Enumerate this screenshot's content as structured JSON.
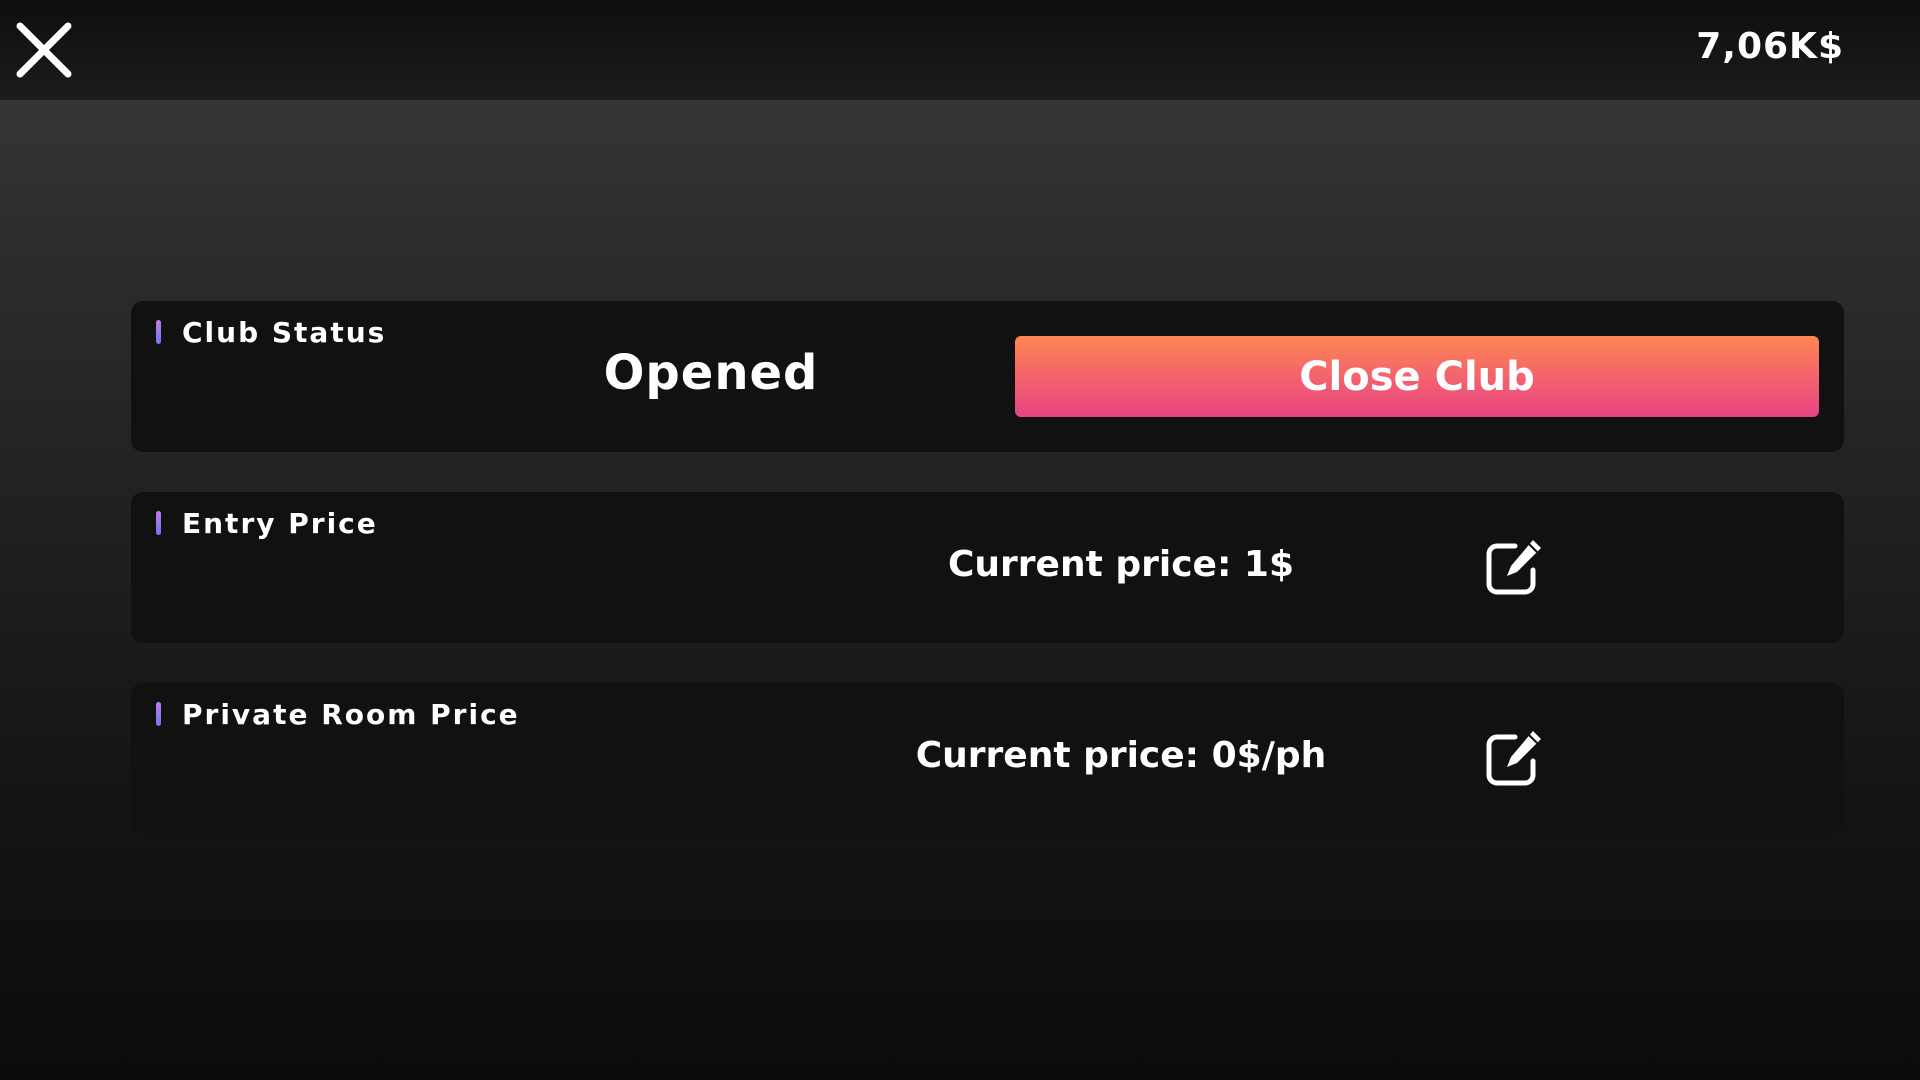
{
  "header": {
    "close_icon": "close-icon",
    "balance": "7,06K$"
  },
  "club_status": {
    "title": "Club Status",
    "status": "Opened",
    "button_label": "Close Club",
    "button_gradient": [
      "#ff8751",
      "#e84482"
    ]
  },
  "entry_price": {
    "title": "Entry Price",
    "price_text": "Current price: 1$",
    "edit_icon": "edit-icon"
  },
  "private_room_price": {
    "title": "Private Room Price",
    "price_text": "Current price: 0$/ph",
    "edit_icon": "edit-icon"
  },
  "colors": {
    "accent_bar_top": "#c37ae6",
    "accent_bar_bottom": "#6d78f0",
    "card_background": "#111111"
  }
}
